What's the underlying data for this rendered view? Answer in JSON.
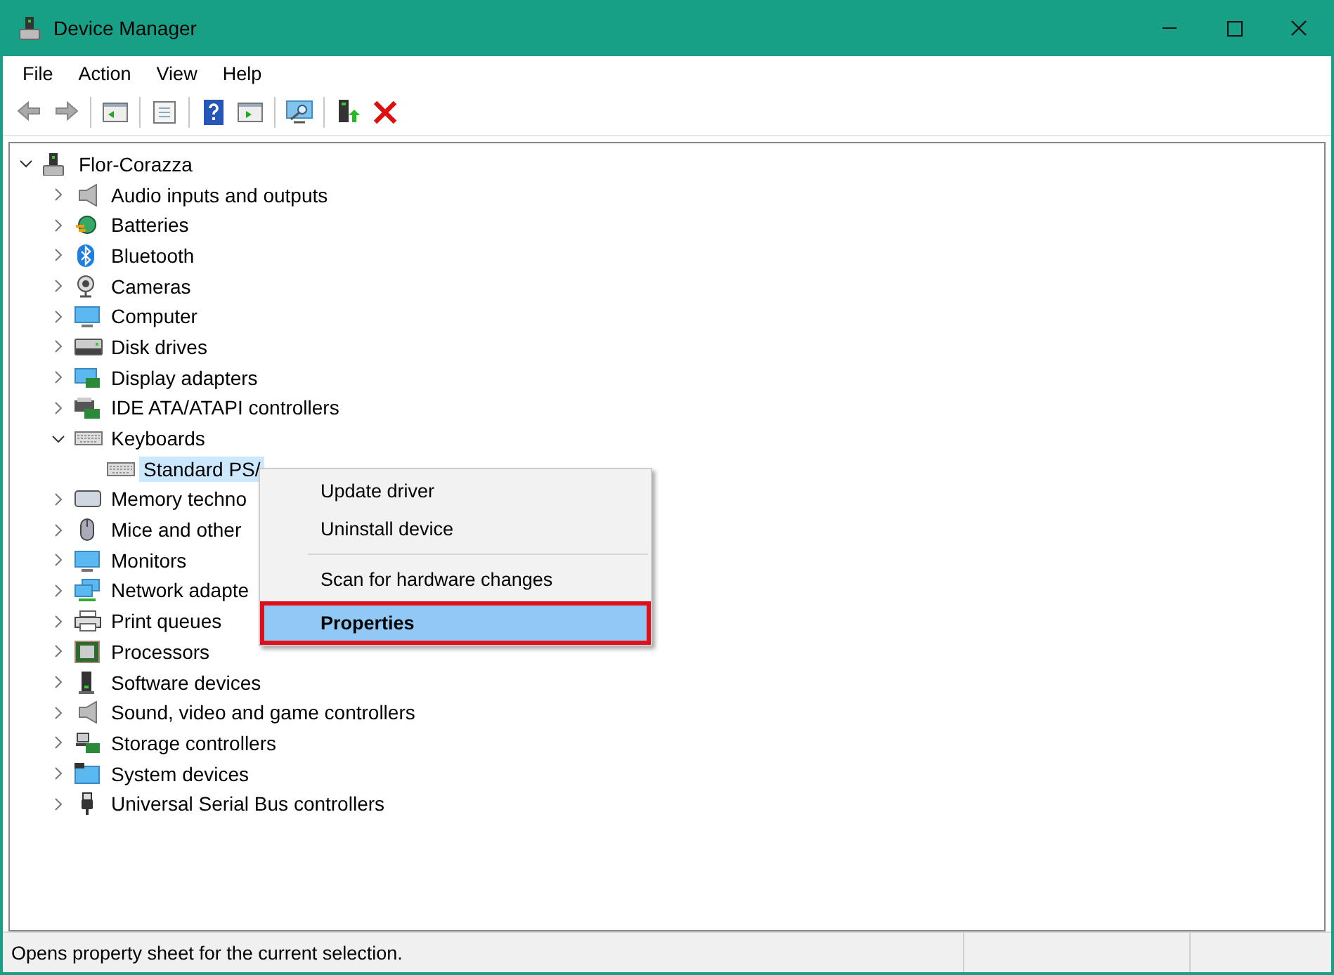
{
  "window": {
    "title": "Device Manager"
  },
  "menu_bar": [
    "File",
    "Action",
    "View",
    "Help"
  ],
  "tree": [
    {
      "label": "Flor-Corazza",
      "expanded": true,
      "selected": false,
      "children": [
        {
          "label": "Audio inputs and outputs",
          "expanded": false,
          "selected": false
        },
        {
          "label": "Batteries",
          "expanded": false,
          "selected": false
        },
        {
          "label": "Bluetooth",
          "expanded": false,
          "selected": false
        },
        {
          "label": "Cameras",
          "expanded": false,
          "selected": false
        },
        {
          "label": "Computer",
          "expanded": false,
          "selected": false
        },
        {
          "label": "Disk drives",
          "expanded": false,
          "selected": false
        },
        {
          "label": "Display adapters",
          "expanded": false,
          "selected": false
        },
        {
          "label": "IDE ATA/ATAPI controllers",
          "expanded": false,
          "selected": false
        },
        {
          "label": "Keyboards",
          "expanded": true,
          "selected": false,
          "children": [
            {
              "label": "Standard PS/",
              "selected": true
            }
          ]
        },
        {
          "label": "Memory techno",
          "expanded": false,
          "selected": false
        },
        {
          "label": "Mice and other",
          "expanded": false,
          "selected": false
        },
        {
          "label": "Monitors",
          "expanded": false,
          "selected": false
        },
        {
          "label": "Network adapte",
          "expanded": false,
          "selected": false
        },
        {
          "label": "Print queues",
          "expanded": false,
          "selected": false
        },
        {
          "label": "Processors",
          "expanded": false,
          "selected": false
        },
        {
          "label": "Software devices",
          "expanded": false,
          "selected": false
        },
        {
          "label": "Sound, video and game controllers",
          "expanded": false,
          "selected": false
        },
        {
          "label": "Storage controllers",
          "expanded": false,
          "selected": false
        },
        {
          "label": "System devices",
          "expanded": false,
          "selected": false
        },
        {
          "label": "Universal Serial Bus controllers",
          "expanded": false,
          "selected": false
        }
      ]
    }
  ],
  "context_menu": [
    {
      "kind": "item",
      "label": "Update driver",
      "selected": false
    },
    {
      "kind": "item",
      "label": "Uninstall device",
      "selected": false
    },
    {
      "kind": "separator"
    },
    {
      "kind": "item",
      "label": "Scan for hardware changes",
      "selected": false
    },
    {
      "kind": "item",
      "label": "Properties",
      "selected": true
    }
  ],
  "status_bar": {
    "text": "Opens property sheet for the current selection."
  }
}
